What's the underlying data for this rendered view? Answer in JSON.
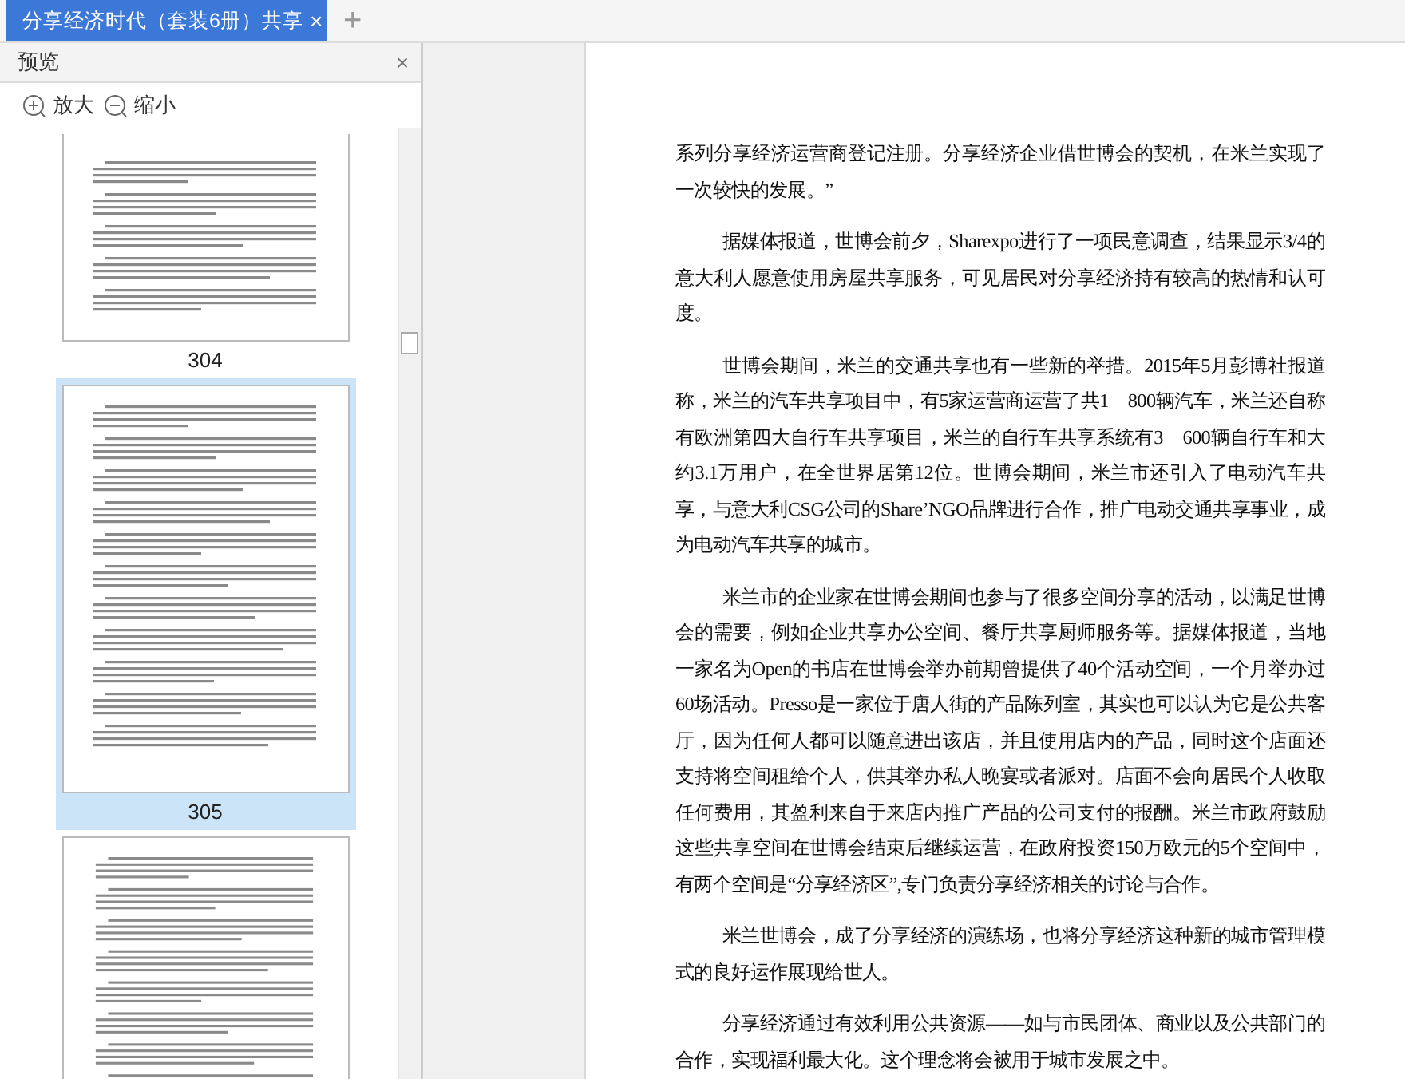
{
  "tab": {
    "title": "分享经济时代（套装6册）共享",
    "close": "×",
    "new_tab": "+"
  },
  "sidebar": {
    "title": "预览",
    "close": "×",
    "zoom_in": "放大",
    "zoom_out": "缩小",
    "thumbnails": [
      {
        "label": "304",
        "selected": false,
        "kind": "cut-top"
      },
      {
        "label": "305",
        "selected": true,
        "kind": "full"
      },
      {
        "selected": false,
        "kind": "cut-bottom"
      }
    ]
  },
  "document": {
    "paragraphs": [
      {
        "kind": "continuation",
        "text": "系列分享经济运营商登记注册。分享经济企业借世博会的契机，在米兰实现了一次较快的发展。”"
      },
      {
        "kind": "indented",
        "text": "据媒体报道，世博会前夕，Sharexpo进行了一项民意调查，结果显示3/4的意大利人愿意使用房屋共享服务，可见居民对分享经济持有较高的热情和认可度。"
      },
      {
        "kind": "indented",
        "text": "世博会期间，米兰的交通共享也有一些新的举措。2015年5月彭博社报道称，米兰的汽车共享项目中，有5家运营商运营了共1　800辆汽车，米兰还自称有欧洲第四大自行车共享项目，米兰的自行车共享系统有3　600辆自行车和大约3.1万用户，在全世界居第12位。世博会期间，米兰市还引入了电动汽车共享，与意大利CSG公司的Share’NGO品牌进行合作，推广电动交通共享事业，成为电动汽车共享的城市。"
      },
      {
        "kind": "indented",
        "text": "米兰市的企业家在世博会期间也参与了很多空间分享的活动，以满足世博会的需要，例如企业共享办公空间、餐厅共享厨师服务等。据媒体报道，当地一家名为Open的书店在世博会举办前期曾提供了40个活动空间，一个月举办过60场活动。Presso是一家位于唐人街的产品陈列室，其实也可以认为它是公共客厅，因为任何人都可以随意进出该店，并且使用店内的产品，同时这个店面还支持将空间租给个人，供其举办私人晚宴或者派对。店面不会向居民个人收取任何费用，其盈利来自于来店内推广产品的公司支付的报酬。米兰市政府鼓励这些共享空间在世博会结束后继续运营，在政府投资150万欧元的5个空间中，有两个空间是“分享经济区”,专门负责分享经济相关的讨论与合作。"
      },
      {
        "kind": "indented",
        "text": "米兰世博会，成了分享经济的演练场，也将分享经济这种新的城市管理模式的良好运作展现给世人。"
      },
      {
        "kind": "indented",
        "text": "分享经济通过有效利用公共资源——如与市民团体、商业以及公共部门的合作，实现福利最大化。这个理念将会被用于城市发展之中。"
      }
    ]
  }
}
